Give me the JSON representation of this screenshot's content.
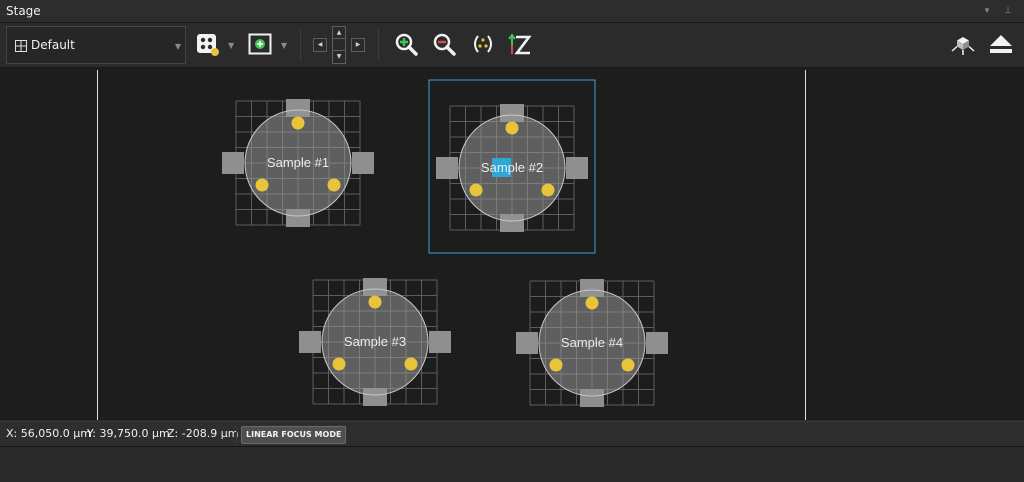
{
  "window": {
    "title": "Stage"
  },
  "toolbar": {
    "layout_value": "Default"
  },
  "samples": [
    {
      "label": "Sample #1",
      "selected": false
    },
    {
      "label": "Sample #2",
      "selected": true
    },
    {
      "label": "Sample #3",
      "selected": false
    },
    {
      "label": "Sample #4",
      "selected": false
    }
  ],
  "status": {
    "x": "X: 56,050.0 µm",
    "y": "Y: 39,750.0 µm",
    "z": "Z: -208.9 µm",
    "focus_mode": "LINEAR FOCUS MODE"
  },
  "colors": {
    "selection": "#2ea6d6",
    "marker": "#e8c43a",
    "zoom_in": "#3fc44f",
    "zoom_out": "#e04848"
  }
}
